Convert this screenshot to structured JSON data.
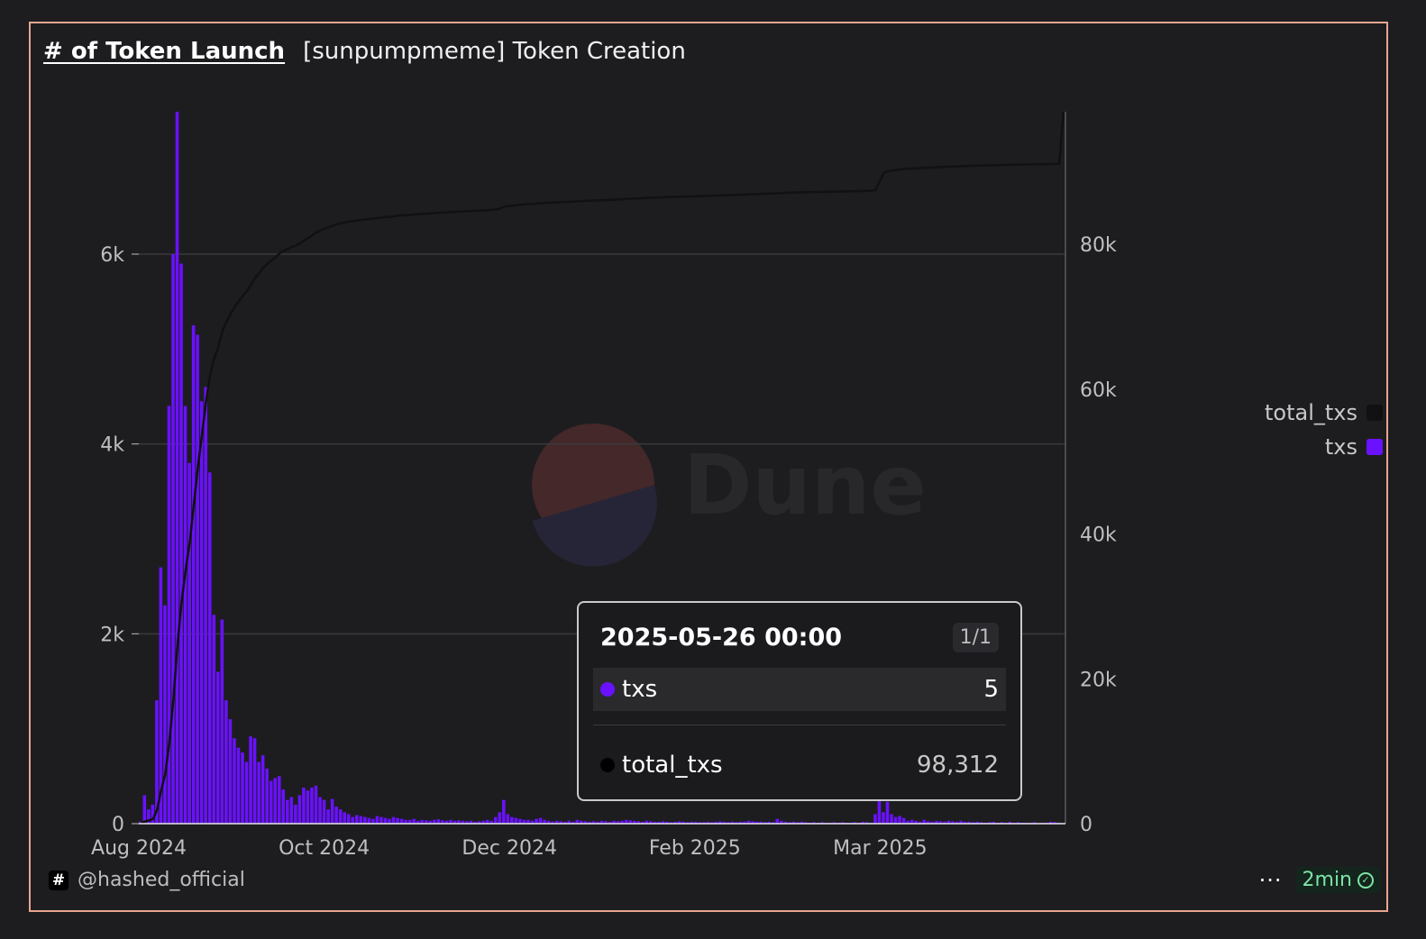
{
  "header": {
    "title": "# of Token Launch",
    "subtitle": "[sunpumpmeme] Token Creation"
  },
  "watermark": {
    "text": "Dune"
  },
  "legend": [
    {
      "name": "total_txs",
      "color": "#111111"
    },
    {
      "name": "txs",
      "color": "#6a11ff"
    }
  ],
  "tooltip": {
    "date": "2025-05-26 00:00",
    "page": "1/1",
    "rows": [
      {
        "name": "txs",
        "value": "5",
        "color": "#6a11ff"
      },
      {
        "name": "total_txs",
        "value": "98,312",
        "color": "#000000"
      }
    ]
  },
  "footer": {
    "author": "@hashed_official",
    "author_badge": "#",
    "more_label": "···",
    "freshness": "2min"
  },
  "colors": {
    "bars": "#6a11ff",
    "line": "#111111",
    "grid": "#3a3a3d",
    "axis_text": "#bfbfbf"
  },
  "chart_data": {
    "type": "bar",
    "x_ticks": [
      "Aug 2024",
      "Oct 2024",
      "Dec 2024",
      "Feb 2025",
      "Mar 2025"
    ],
    "y_left": {
      "ticks": [
        "0",
        "2k",
        "4k",
        "6k"
      ],
      "values": [
        0,
        2000,
        4000,
        6000
      ],
      "max": 7500
    },
    "y_right": {
      "ticks": [
        "0",
        "20k",
        "40k",
        "60k",
        "80k"
      ],
      "values": [
        0,
        20000,
        40000,
        60000,
        80000
      ],
      "max": 98312
    },
    "series": [
      {
        "name": "txs",
        "kind": "bar",
        "values": [
          20,
          300,
          150,
          200,
          1300,
          2700,
          2300,
          4400,
          6000,
          7500,
          5900,
          4400,
          3800,
          5250,
          5150,
          4450,
          4600,
          3700,
          2200,
          1600,
          2150,
          1300,
          1100,
          900,
          800,
          750,
          650,
          920,
          900,
          650,
          720,
          580,
          450,
          480,
          500,
          360,
          250,
          280,
          200,
          300,
          380,
          350,
          380,
          400,
          280,
          250,
          150,
          260,
          180,
          150,
          120,
          100,
          70,
          90,
          80,
          70,
          60,
          50,
          80,
          70,
          60,
          50,
          70,
          60,
          50,
          40,
          40,
          50,
          30,
          40,
          35,
          30,
          40,
          45,
          35,
          30,
          40,
          30,
          35,
          30,
          25,
          30,
          20,
          25,
          30,
          40,
          30,
          70,
          120,
          250,
          100,
          70,
          60,
          50,
          40,
          40,
          30,
          50,
          60,
          40,
          30,
          20,
          30,
          25,
          20,
          30,
          20,
          40,
          30,
          25,
          20,
          25,
          20,
          30,
          25,
          20,
          30,
          25,
          30,
          40,
          35,
          30,
          25,
          20,
          30,
          25,
          20,
          20,
          25,
          20,
          15,
          20,
          25,
          20,
          15,
          20,
          20,
          15,
          15,
          20,
          15,
          20,
          25,
          20,
          15,
          20,
          15,
          20,
          20,
          30,
          25,
          20,
          20,
          15,
          20,
          15,
          50,
          30,
          20,
          15,
          20,
          15,
          20,
          15,
          10,
          15,
          10,
          15,
          10,
          10,
          15,
          10,
          15,
          10,
          10,
          15,
          10,
          20,
          15,
          10,
          100,
          250,
          120,
          230,
          100,
          70,
          80,
          60,
          30,
          40,
          30,
          20,
          40,
          25,
          20,
          30,
          25,
          20,
          30,
          25,
          20,
          30,
          20,
          20,
          15,
          20,
          15,
          10,
          15,
          20,
          10,
          15,
          10,
          20,
          10,
          15,
          10,
          10,
          10,
          15,
          5,
          10,
          10,
          20,
          15,
          10,
          5
        ]
      },
      {
        "name": "total_txs",
        "kind": "line",
        "values": [
          0,
          300,
          450,
          650,
          1950,
          4650,
          6950,
          11350,
          17350,
          24850,
          30750,
          35150,
          38950,
          44200,
          49350,
          53800,
          58400,
          62100,
          64300,
          65900,
          68050,
          69350,
          70450,
          71350,
          72150,
          72900,
          73550,
          74470,
          75370,
          76020,
          76740,
          77320,
          77770,
          78250,
          78750,
          79110,
          79360,
          79640,
          79840,
          80140,
          80520,
          80870,
          81250,
          81650,
          81930,
          82180,
          82330,
          82590,
          82770,
          82920,
          83040,
          83140,
          83210,
          83300,
          83380,
          83450,
          83510,
          83560,
          83640,
          83710,
          83770,
          83820,
          83890,
          83950,
          84000,
          84040,
          84080,
          84130,
          84160,
          84200,
          84235,
          84265,
          84305,
          84350,
          84385,
          84415,
          84455,
          84485,
          84520,
          84550,
          84575,
          84605,
          84625,
          84650,
          84680,
          84720,
          84750,
          84820,
          84940,
          85190,
          85290,
          85360,
          85420,
          85470,
          85510,
          85550,
          85580,
          85630,
          85690,
          85730,
          85760,
          85780,
          85810,
          85835,
          85855,
          85885,
          85905,
          85945,
          85975,
          86000,
          86020,
          86045,
          86065,
          86095,
          86120,
          86140,
          86170,
          86195,
          86225,
          86265,
          86300,
          86330,
          86355,
          86375,
          86405,
          86430,
          86450,
          86470,
          86495,
          86515,
          86530,
          86550,
          86575,
          86595,
          86610,
          86630,
          86650,
          86665,
          86680,
          86700,
          86715,
          86735,
          86760,
          86780,
          86795,
          86815,
          86830,
          86850,
          86870,
          86900,
          86925,
          86945,
          86965,
          86980,
          87000,
          87015,
          87065,
          87095,
          87115,
          87130,
          87150,
          87165,
          87185,
          87200,
          87210,
          87225,
          87235,
          87250,
          87260,
          87270,
          87285,
          87295,
          87310,
          87320,
          87330,
          87345,
          87355,
          87375,
          87390,
          87400,
          87500,
          88750,
          89870,
          90100,
          90200,
          90270,
          90350,
          90410,
          90440,
          90480,
          90510,
          90530,
          90570,
          90595,
          90615,
          90645,
          90670,
          90690,
          90720,
          90745,
          90765,
          90795,
          90815,
          90835,
          90850,
          90870,
          90885,
          90895,
          90910,
          90930,
          90940,
          90955,
          90965,
          90985,
          90995,
          91010,
          91020,
          91030,
          91040,
          91055,
          91060,
          91070,
          91080,
          91100,
          91115,
          91125,
          98312
        ]
      }
    ]
  }
}
